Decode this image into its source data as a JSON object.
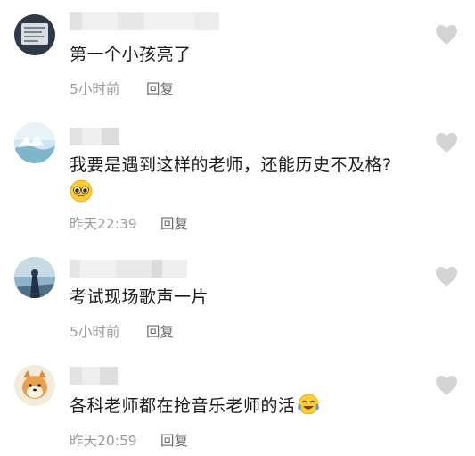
{
  "comments": [
    {
      "text": "第一个小孩亮了",
      "time": "5小时前",
      "reply": "回复"
    },
    {
      "text": "我要是遇到这样的老师，还能历史不及格?",
      "time": "昨天22:39",
      "reply": "回复"
    },
    {
      "text": "考试现场歌声一片",
      "time": "5小时前",
      "reply": "回复"
    },
    {
      "text": "各科老师都在抢音乐老师的活",
      "time": "昨天20:59",
      "reply": "回复"
    }
  ],
  "icons": {
    "like": "heart-icon",
    "emoji_pleading": "pleading-face-emoji",
    "emoji_laughing": "tears-of-joy-emoji"
  },
  "colors": {
    "text": "#1b1b1b",
    "meta": "#9b9b9b",
    "heart": "#d4d4d4"
  }
}
